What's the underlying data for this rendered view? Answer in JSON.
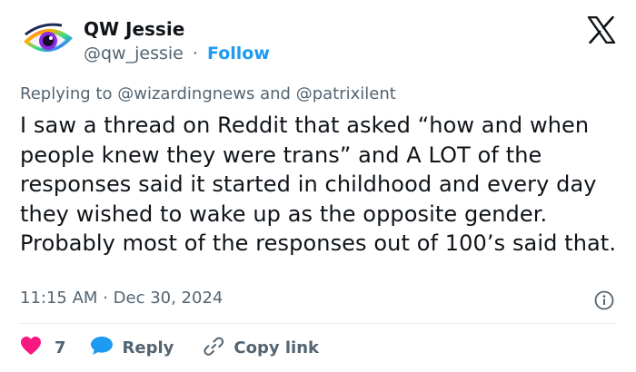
{
  "author": {
    "name": "QW Jessie",
    "handle": "@qw_jessie",
    "separator": "·",
    "follow_label": "Follow"
  },
  "reply_context": {
    "prefix": "Replying to",
    "mention_1": "@wizardingnews",
    "conjunction": "and",
    "mention_2": "@patrixilent"
  },
  "tweet": {
    "text": "I saw a thread on Reddit that asked “how and when people knew they were trans” and A LOT of the responses said it started in childhood and every day they wished to wake up as the opposite gender. Probably most of the responses out of 100’s said that.",
    "time": "11:15 AM",
    "separator": "·",
    "date": "Dec 30, 2024"
  },
  "actions": {
    "like_count": "7",
    "reply_label": "Reply",
    "copy_link_label": "Copy link"
  },
  "icons": {
    "brand": "x-logo-icon",
    "info": "info-icon",
    "like": "heart-icon",
    "reply": "speech-bubble-icon",
    "copy": "link-icon"
  },
  "colors": {
    "accent": "#1d9bf0",
    "like": "#f91880",
    "muted": "#536471",
    "text": "#0f1419"
  }
}
